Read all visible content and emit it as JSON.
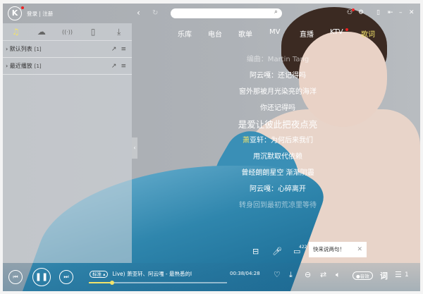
{
  "header": {
    "logo": "K",
    "login": "登录",
    "register": "注册",
    "search_placeholder": ""
  },
  "sidebar": {
    "tabs": [
      "♫",
      "☁",
      "((·))",
      "▯",
      "⤓"
    ],
    "lists": [
      {
        "name": "默认列表",
        "count": "[1]"
      },
      {
        "name": "最近播放",
        "count": "[1]"
      }
    ]
  },
  "nav": {
    "items": [
      "乐库",
      "电台",
      "歌单",
      "MV",
      "直播",
      "KTV",
      "歌词"
    ]
  },
  "lyrics": {
    "credit": "编曲：Martin Tang",
    "lines": [
      "阿云嘎：还记得吗",
      "窗外那被月光染亮的海洋",
      "你还记得吗",
      "是爱让彼此把夜点亮",
      "亚轩：为何后来我们",
      "用沉默取代依赖",
      "曾经朗朗星空 渐渐阴霾",
      "阿云嘎：心碎离开",
      "转身回到最初荒凉里等待"
    ],
    "current_prefix": "萧"
  },
  "comment": {
    "count": "422",
    "tip": "快来说两句！"
  },
  "player": {
    "quality": "标准 ▴",
    "song": "Live)   萧亚轩、阿云嘎 - 最熟悉的l",
    "time": "00:38/04:28",
    "progress": 0.17,
    "sound_label": "音效",
    "lyric_btn": "词",
    "playlist_count": "1"
  },
  "colors": {
    "accent": "#f2e36b",
    "badge": "#e22222"
  }
}
